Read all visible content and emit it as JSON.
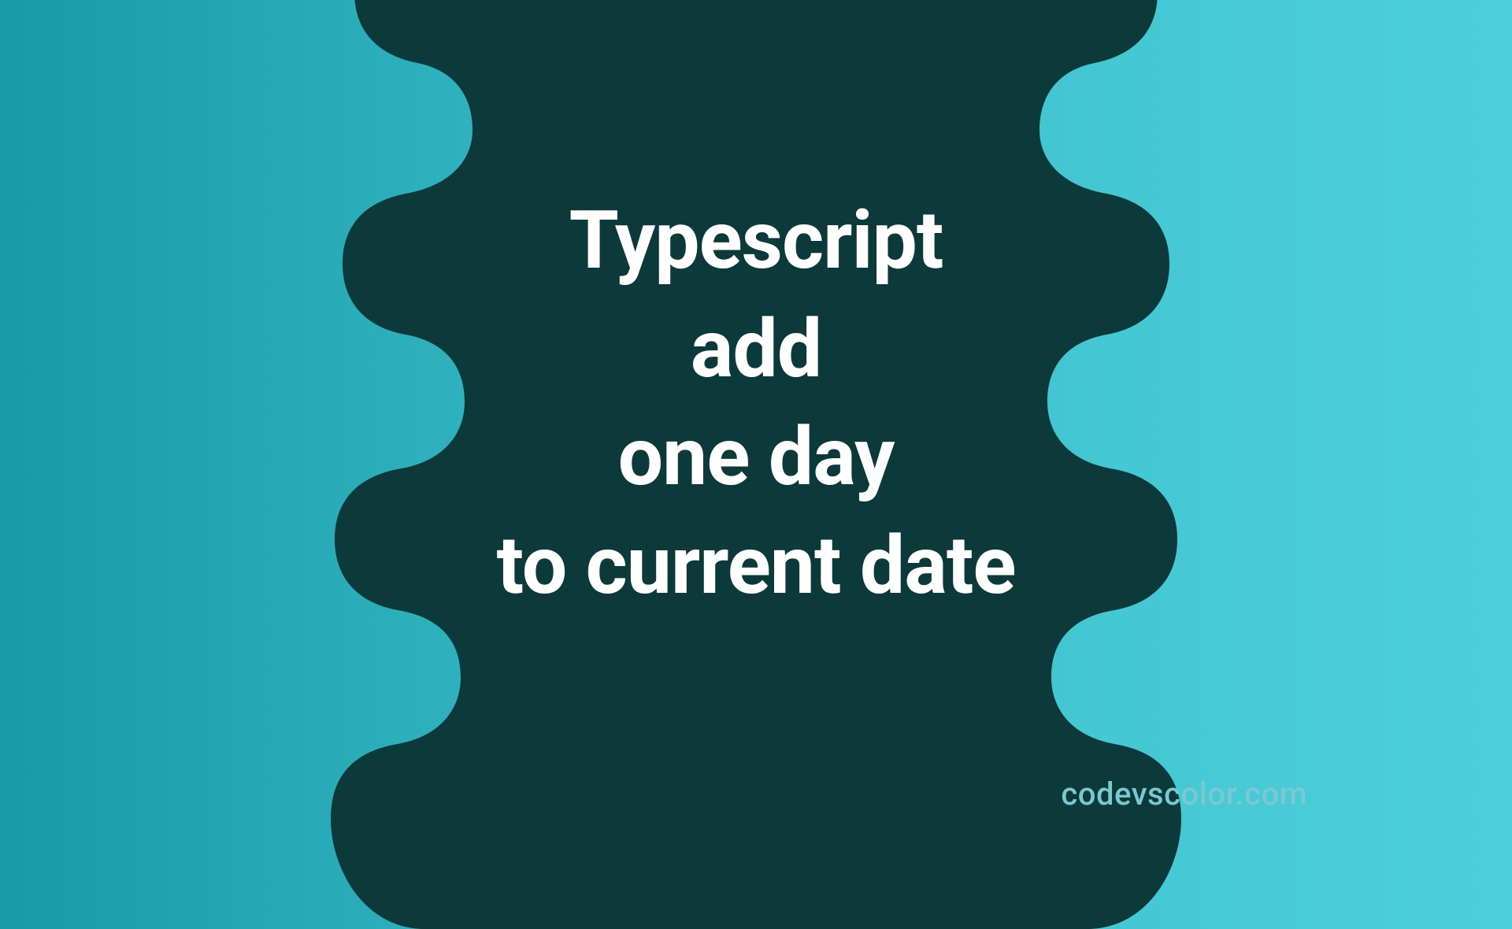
{
  "title": {
    "line1": "Typescript",
    "line2": "add",
    "line3": "one day",
    "line4": "to current date"
  },
  "watermark": "codevscolor.com",
  "colors": {
    "blob": "#0c3a3a",
    "text": "#ffffff",
    "watermark": "#7cc8d0",
    "bg_start": "#1a9aa8",
    "bg_end": "#4dd0dc"
  }
}
